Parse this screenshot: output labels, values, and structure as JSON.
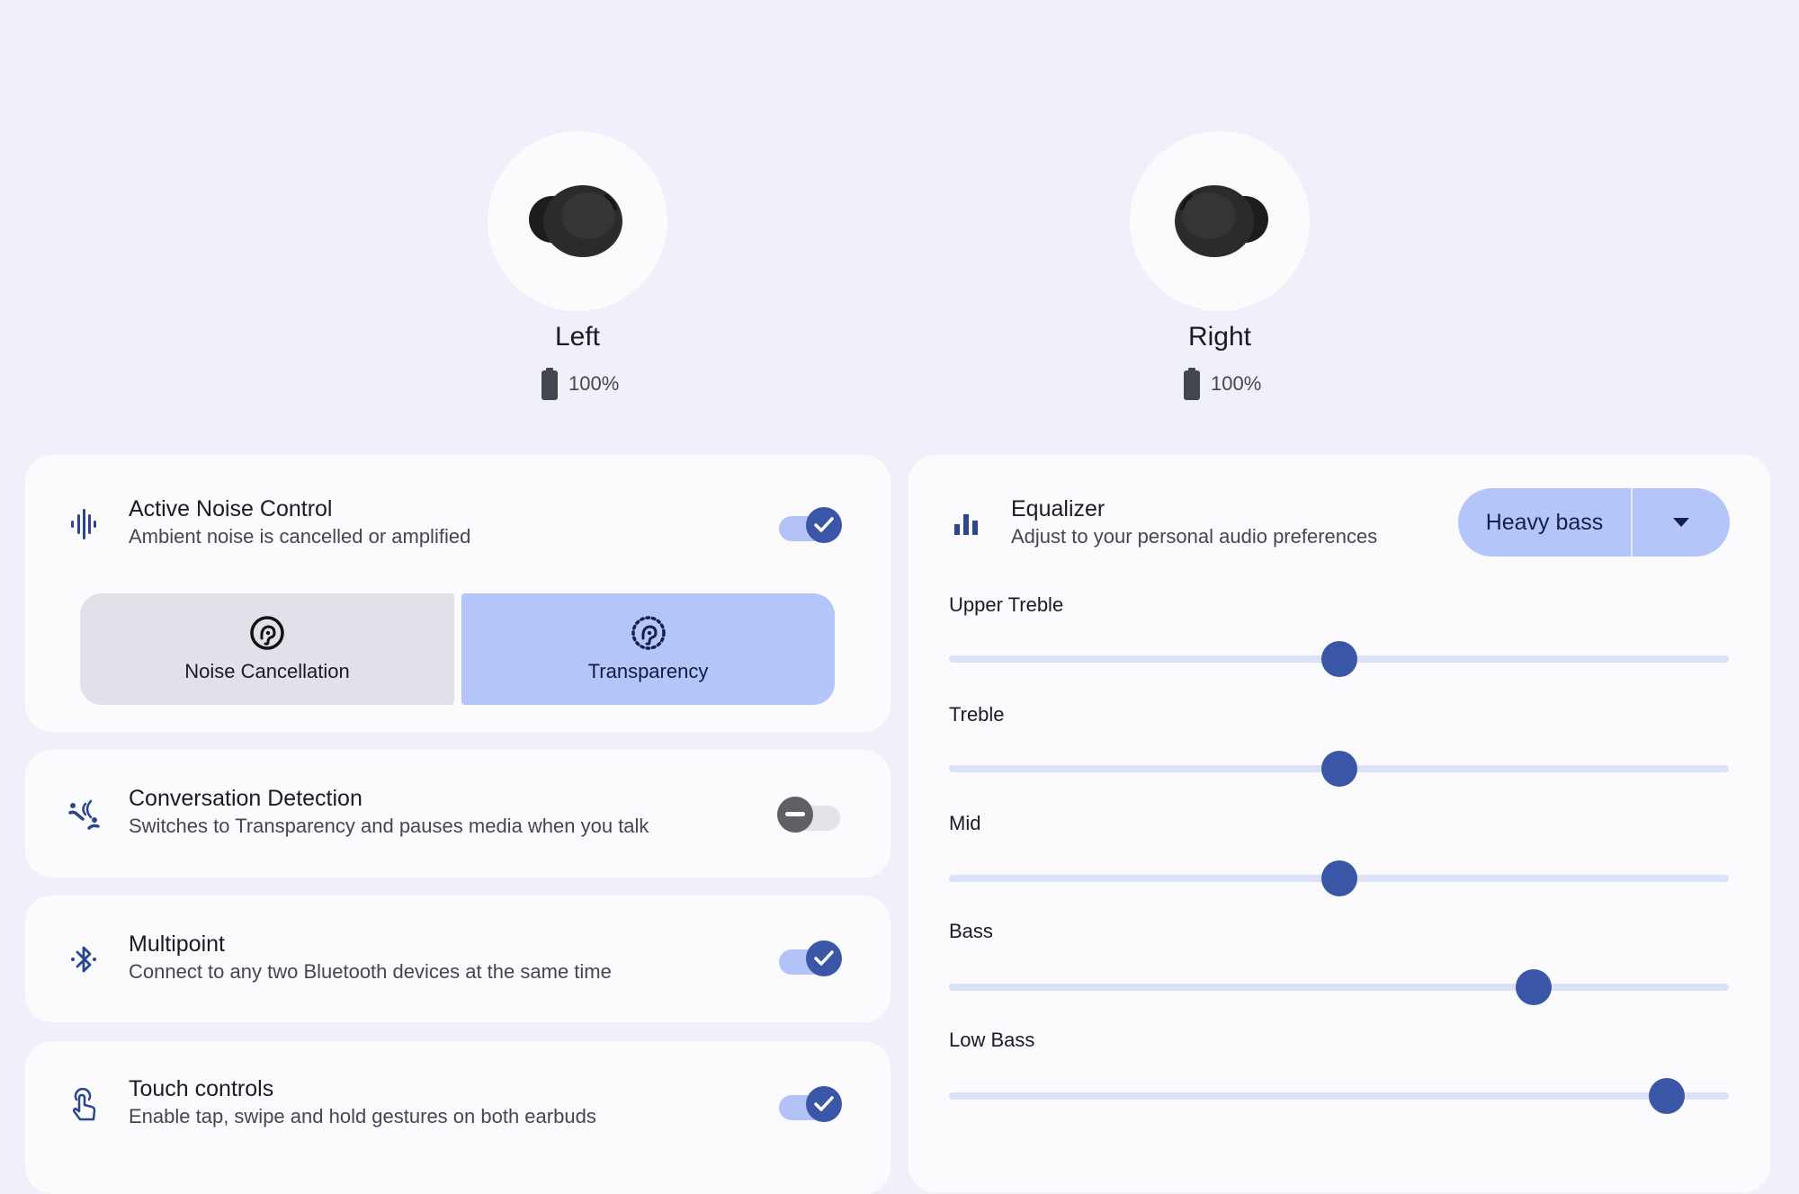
{
  "earbuds": [
    {
      "name": "Left",
      "battery": "100%",
      "battery_percent": 100,
      "icon": "earbud-left-image"
    },
    {
      "name": "Right",
      "battery": "100%",
      "battery_percent": 100,
      "icon": "earbud-right-image"
    }
  ],
  "settings": {
    "anc": {
      "title": "Active Noise Control",
      "subtitle": "Ambient noise is cancelled or amplified",
      "icon": "sound-wave-icon",
      "enabled": true,
      "modes": [
        {
          "label": "Noise Cancellation",
          "icon": "ear-noise-cancel-icon",
          "selected": false
        },
        {
          "label": "Transparency",
          "icon": "ear-transparency-icon",
          "selected": true
        }
      ]
    },
    "conversation": {
      "title": "Conversation Detection",
      "subtitle": "Switches to Transparency and pauses media when you talk",
      "icon": "conversation-icon",
      "enabled": false
    },
    "multipoint": {
      "title": "Multipoint",
      "subtitle": "Connect to any two Bluetooth devices at the same time",
      "icon": "bluetooth-icon",
      "enabled": true
    },
    "touch": {
      "title": "Touch controls",
      "subtitle": "Enable tap, swipe and hold gestures on both earbuds",
      "icon": "touch-gesture-icon",
      "enabled": true
    }
  },
  "equalizer": {
    "title": "Equalizer",
    "subtitle": "Adjust to your personal audio preferences",
    "icon": "equalizer-icon",
    "preset": "Heavy bass",
    "bands": [
      {
        "label": "Upper Treble",
        "value": 0.5
      },
      {
        "label": "Treble",
        "value": 0.5
      },
      {
        "label": "Mid",
        "value": 0.5
      },
      {
        "label": "Bass",
        "value": 0.75
      },
      {
        "label": "Low Bass",
        "value": 0.92
      }
    ]
  },
  "colors": {
    "accent": "#3a56a7",
    "accent_container": "#b3c5f9",
    "background": "#eff0fa",
    "card": "#fbfbfe"
  }
}
